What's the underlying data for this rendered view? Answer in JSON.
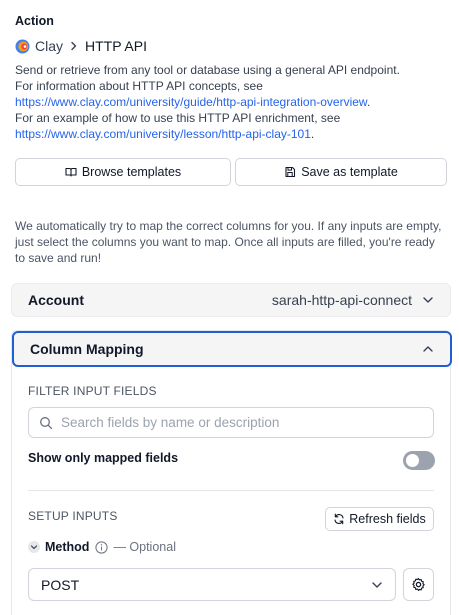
{
  "section": {
    "label": "Action"
  },
  "breadcrumb": {
    "app": "Clay",
    "current": "HTTP API"
  },
  "description": {
    "line1": "Send or retrieve from any tool or database using a general API endpoint.",
    "line2": "For information about HTTP API concepts, see",
    "link1": "https://www.clay.com/university/guide/http-api-integration-overview",
    "line3": "For an example of how to use this HTTP API enrichment, see",
    "link2": "https://www.clay.com/university/lesson/http-api-clay-101"
  },
  "templates": {
    "browse_label": "Browse templates",
    "save_label": "Save as template"
  },
  "auto_text": "We automatically try to map the correct columns for you. If any inputs are empty, just select the columns you want to map. Once all inputs are filled, you're ready to save and run!",
  "account": {
    "label": "Account",
    "value": "sarah-http-api-connect"
  },
  "mapping": {
    "title": "Column Mapping",
    "filter_heading": "FILTER INPUT FIELDS",
    "search_placeholder": "Search fields by name or description",
    "show_mapped_label": "Show only mapped fields",
    "setup_heading": "SETUP INPUTS",
    "refresh_label": "Refresh fields",
    "method_label": "Method",
    "method_optional": "— Optional",
    "method_value": "POST"
  },
  "colors": {
    "accent": "#1e5fd6",
    "link": "#2563eb",
    "header_bg": "#f5f5f6"
  },
  "icons": [
    "clay-logo",
    "chevron-right-icon",
    "book-open-icon",
    "save-icon",
    "chevron-down-icon",
    "chevron-up-icon",
    "search-icon",
    "refresh-icon",
    "info-icon",
    "gear-icon"
  ]
}
